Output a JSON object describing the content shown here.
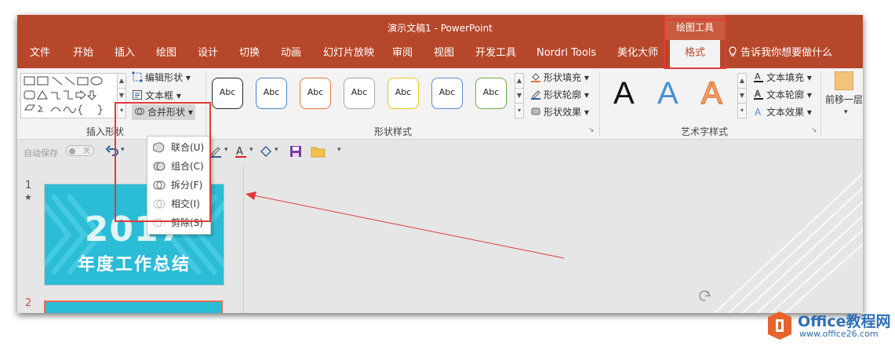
{
  "window": {
    "title": "演示文稿1  -  PowerPoint"
  },
  "contextual_tab_group": {
    "label": "绘图工具"
  },
  "tabs": [
    {
      "label": "文件"
    },
    {
      "label": "开始"
    },
    {
      "label": "插入"
    },
    {
      "label": "绘图"
    },
    {
      "label": "设计"
    },
    {
      "label": "切换"
    },
    {
      "label": "动画"
    },
    {
      "label": "幻灯片放映"
    },
    {
      "label": "审阅"
    },
    {
      "label": "视图"
    },
    {
      "label": "开发工具"
    },
    {
      "label": "Nordri Tools"
    },
    {
      "label": "美化大师"
    },
    {
      "label": "格式",
      "active": true
    }
  ],
  "tell_me": "告诉我你想要做什么",
  "ribbon": {
    "insert_shapes": {
      "label": "插入形状",
      "edit_shape": "编辑形状",
      "text_box": "文本框",
      "merge_shapes": "合并形状"
    },
    "shape_styles": {
      "label": "形状样式",
      "presets": [
        {
          "text": "Abc",
          "color": "#222222"
        },
        {
          "text": "Abc",
          "color": "#4a86c8"
        },
        {
          "text": "Abc",
          "color": "#e47b39"
        },
        {
          "text": "Abc",
          "color": "#a5a5a5"
        },
        {
          "text": "Abc",
          "color": "#f2c314"
        },
        {
          "text": "Abc",
          "color": "#5b8bd0"
        },
        {
          "text": "Abc",
          "color": "#70ad47"
        }
      ],
      "fill": "形状填充",
      "outline": "形状轮廓",
      "effects": "形状效果"
    },
    "wordart_styles": {
      "label": "艺术字样式",
      "samples": [
        "A",
        "A",
        "A"
      ],
      "text_fill": "文本填充",
      "text_outline": "文本轮廓",
      "text_effects": "文本效果"
    },
    "arrange": {
      "bring_forward": "前移一层"
    }
  },
  "merge_menu": {
    "items": [
      {
        "label": "联合(U)"
      },
      {
        "label": "组合(C)"
      },
      {
        "label": "拆分(F)"
      },
      {
        "label": "相交(I)"
      },
      {
        "label": "剪除(S)"
      }
    ]
  },
  "qat": {
    "autosave": "自动保存",
    "toggle": "关"
  },
  "slides": [
    {
      "number": "1",
      "star": "★",
      "year": "2017",
      "subtitle": "年度工作总结"
    },
    {
      "number": "2"
    }
  ],
  "watermark": {
    "title": "Office教程网",
    "url": "www.office26.com"
  }
}
